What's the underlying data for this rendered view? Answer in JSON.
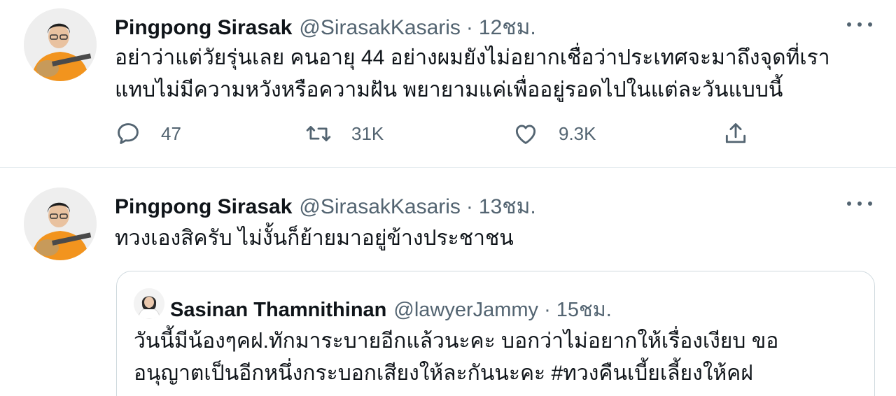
{
  "tweets": [
    {
      "author_name": "Pingpong Sirasak",
      "author_handle": "@SirasakKasaris",
      "separator": "·",
      "time": "12ชม.",
      "text_lines": [
        "อย่าว่าแต่วัยรุ่นเลย คนอายุ 44 อย่างผมยังไม่อยากเชื่อว่าประเทศจะมาถึงจุดที่เรา",
        "แทบไม่มีความหวังหรือความฝัน พยายามแค่เพื่ออยู่รอดไปในแต่ละวันแบบนี้"
      ],
      "replies": "47",
      "retweets": "31K",
      "likes": "9.3K"
    },
    {
      "author_name": "Pingpong Sirasak",
      "author_handle": "@SirasakKasaris",
      "separator": "·",
      "time": "13ชม.",
      "text_lines": [
        "ทวงเองสิครับ ไม่งั้นก็ย้ายมาอยู่ข้างประชาชน"
      ],
      "quote": {
        "author_name": "Sasinan Thamnithinan",
        "author_handle": "@lawyerJammy",
        "separator": "·",
        "time": "15ชม.",
        "text_lines": [
          "วันนี้มีน้องๆคฝ.ทักมาระบายอีกแล้วนะคะ บอกว่าไม่อยากให้เรื่องเงียบ ขอ",
          "อนุญาตเป็นอีกหนึ่งกระบอกเสียงให้ละกันนะคะ #ทวงคืนเบี้ยเลี้ยงให้คฝ"
        ]
      }
    }
  ],
  "icons": {
    "reply": "reply-icon",
    "retweet": "retweet-icon",
    "like": "like-icon",
    "share": "share-icon",
    "more": "more-icon"
  },
  "colors": {
    "text": "#0f1419",
    "secondary": "#536471",
    "border": "#cfd9de",
    "shirt": "#f2941e"
  }
}
